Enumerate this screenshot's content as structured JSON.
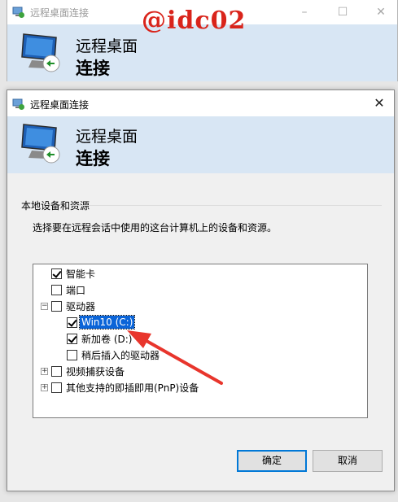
{
  "watermark": "@idc02",
  "background_window": {
    "title": "远程桌面连接",
    "banner_line1": "远程桌面",
    "banner_line2": "连接"
  },
  "dialog": {
    "title": "远程桌面连接",
    "close_glyph": "✕",
    "banner_line1": "远程桌面",
    "banner_line2": "连接",
    "group_label": "本地设备和资源",
    "description": "选择要在远程会话中使用的这台计算机上的设备和资源。",
    "tree": [
      {
        "id": "smartcard",
        "label": "智能卡",
        "checked": true,
        "expander": ""
      },
      {
        "id": "port",
        "label": "端口",
        "checked": false,
        "expander": ""
      },
      {
        "id": "drives",
        "label": "驱动器",
        "checked": false,
        "expander": "−"
      },
      {
        "id": "drive-c",
        "label": "Win10 (C:)",
        "checked": true,
        "selected": true
      },
      {
        "id": "drive-d",
        "label": "新加卷 (D:)",
        "checked": true
      },
      {
        "id": "later-drives",
        "label": "稍后插入的驱动器",
        "checked": false
      },
      {
        "id": "video-capture",
        "label": "视频捕获设备",
        "checked": false,
        "expander": "+"
      },
      {
        "id": "pnp",
        "label": "其他支持的即插即用(PnP)设备",
        "checked": false,
        "expander": "+"
      }
    ],
    "ok_label": "确定",
    "cancel_label": "取消"
  },
  "colors": {
    "banner": "#d8e6f4",
    "selection": "#0a64d8",
    "arrow": "#e8352c",
    "watermark": "#d9241b",
    "default_button_border": "#0078d7"
  },
  "icons": {
    "app": "remote-desktop-icon",
    "banner": "remote-desktop-monitor-icon"
  }
}
